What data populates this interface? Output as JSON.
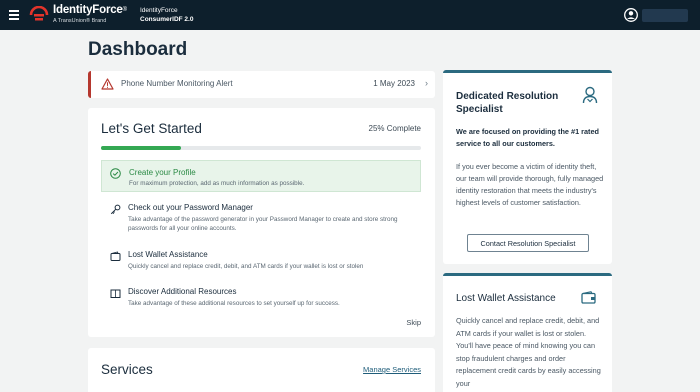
{
  "header": {
    "brand_name": "IdentityForce",
    "brand_reg": "®",
    "brand_tagline": "A TransUnion® Brand",
    "product_line1": "IdentityForce",
    "product_line2": "ConsumerIDF 2.0"
  },
  "page": {
    "title": "Dashboard"
  },
  "alert": {
    "label": "Phone Number Monitoring Alert",
    "date": "1 May 2023",
    "accent_color": "#b5372e"
  },
  "getting_started": {
    "title": "Let's Get Started",
    "progress_label": "25% Complete",
    "progress_value": 0.25,
    "tasks": [
      {
        "title": "Create your Profile",
        "description": "For maximum protection, add as much information as possible.",
        "icon": "check-circle-icon",
        "completed": true
      },
      {
        "title": "Check out your Password Manager",
        "description": "Take advantage of the password generator in your Password Manager to create and store strong passwords for all your online accounts.",
        "icon": "key-icon",
        "completed": false
      },
      {
        "title": "Lost Wallet Assistance",
        "description": "Quickly cancel and replace credit, debit, and ATM cards if your wallet is lost or stolen",
        "icon": "wallet-icon",
        "completed": false
      },
      {
        "title": "Discover Additional Resources",
        "description": "Take advantage of these additional resources to set yourself up for success.",
        "icon": "book-icon",
        "completed": false
      }
    ],
    "skip_label": "Skip"
  },
  "services": {
    "title": "Services",
    "manage_label": "Manage Services"
  },
  "dedicated_resolution": {
    "title": "Dedicated Resolution Specialist",
    "bold_text": "We are focused on providing the #1 rated service to all our customers.",
    "body_text": "If you ever become a victim of identity theft, our team will provide thorough, fully managed identity restoration that meets the industry's highest levels of customer satisfaction.",
    "button_label": "Contact Resolution Specialist",
    "icon": "person-icon"
  },
  "lost_wallet": {
    "title": "Lost Wallet Assistance",
    "body_text": "Quickly cancel and replace credit, debit, and ATM cards if your wallet is lost or stolen. You'll have peace of mind knowing you can stop fraudulent charges and order replacement credit cards by easily accessing your",
    "icon": "wallet-icon"
  },
  "colors": {
    "header_bg": "#0d1f2c",
    "brand_red": "#e2342b",
    "progress_green": "#34a853",
    "side_accent": "#2b6a80"
  }
}
